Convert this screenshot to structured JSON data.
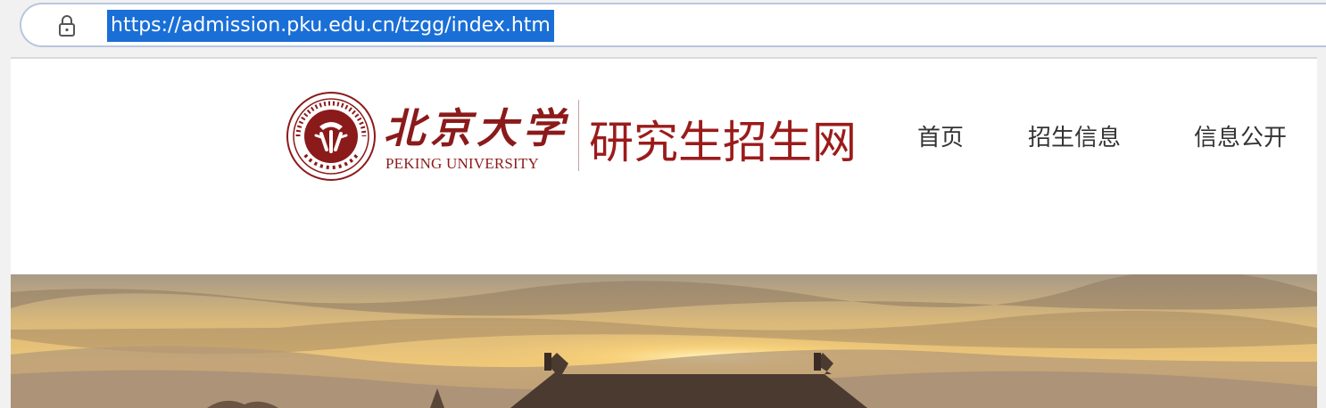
{
  "browser": {
    "url": "https://admission.pku.edu.cn/tzgg/index.htm",
    "lock_icon": "lock-icon"
  },
  "header": {
    "logo_calligraphy": "北京大学",
    "logo_english": "PEKING UNIVERSITY",
    "site_title": "研究生招生网",
    "nav": [
      {
        "label": "首页"
      },
      {
        "label": "招生信息"
      },
      {
        "label": "信息公开"
      }
    ]
  },
  "colors": {
    "brand_red": "#9b1b1b",
    "url_highlight": "#1a6fd6",
    "nav_text": "#333333"
  }
}
